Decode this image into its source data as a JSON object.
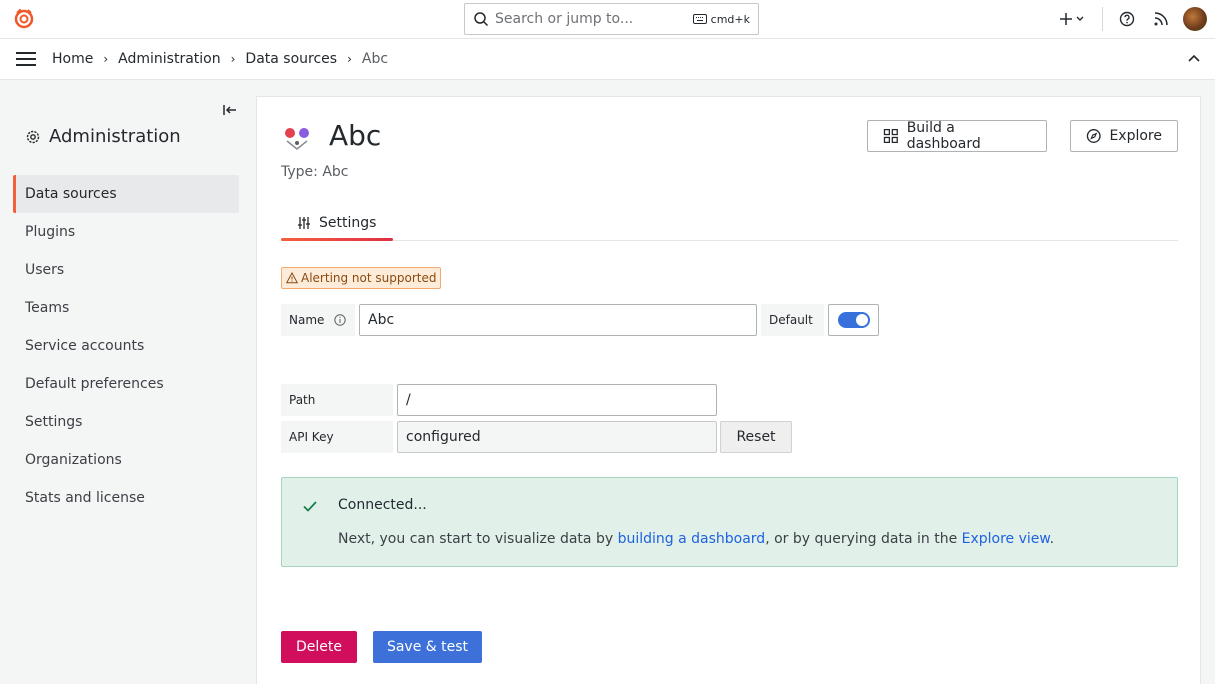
{
  "search": {
    "placeholder": "Search or jump to...",
    "shortcut": "cmd+k"
  },
  "breadcrumb": [
    "Home",
    "Administration",
    "Data sources",
    "Abc"
  ],
  "sidebar": {
    "title": "Administration",
    "items": [
      {
        "label": "Data sources",
        "active": true
      },
      {
        "label": "Plugins"
      },
      {
        "label": "Users"
      },
      {
        "label": "Teams"
      },
      {
        "label": "Service accounts"
      },
      {
        "label": "Default preferences"
      },
      {
        "label": "Settings"
      },
      {
        "label": "Organizations"
      },
      {
        "label": "Stats and license"
      }
    ]
  },
  "datasource": {
    "title": "Abc",
    "type": "Type: Abc"
  },
  "actions": {
    "build_dashboard": "Build a dashboard",
    "explore": "Explore"
  },
  "tabs": [
    {
      "label": "Settings"
    }
  ],
  "warning": "Alerting not supported",
  "form": {
    "name_label": "Name",
    "name_value": "Abc",
    "default_label": "Default",
    "default_on": true,
    "path_label": "Path",
    "path_value": "/",
    "apikey_label": "API Key",
    "apikey_value": "configured",
    "reset_label": "Reset"
  },
  "alert": {
    "title": "Connected...",
    "text_before": "Next, you can start to visualize data by ",
    "link1": "building a dashboard",
    "text_middle": ", or by querying data in the ",
    "link2": "Explore view",
    "text_after": "."
  },
  "footer": {
    "delete": "Delete",
    "save": "Save & test"
  },
  "colors": {
    "primary": "#3d71d9",
    "danger": "#d10e5c",
    "success_bg": "#e1f1ea",
    "accent": "#f55f3e"
  }
}
